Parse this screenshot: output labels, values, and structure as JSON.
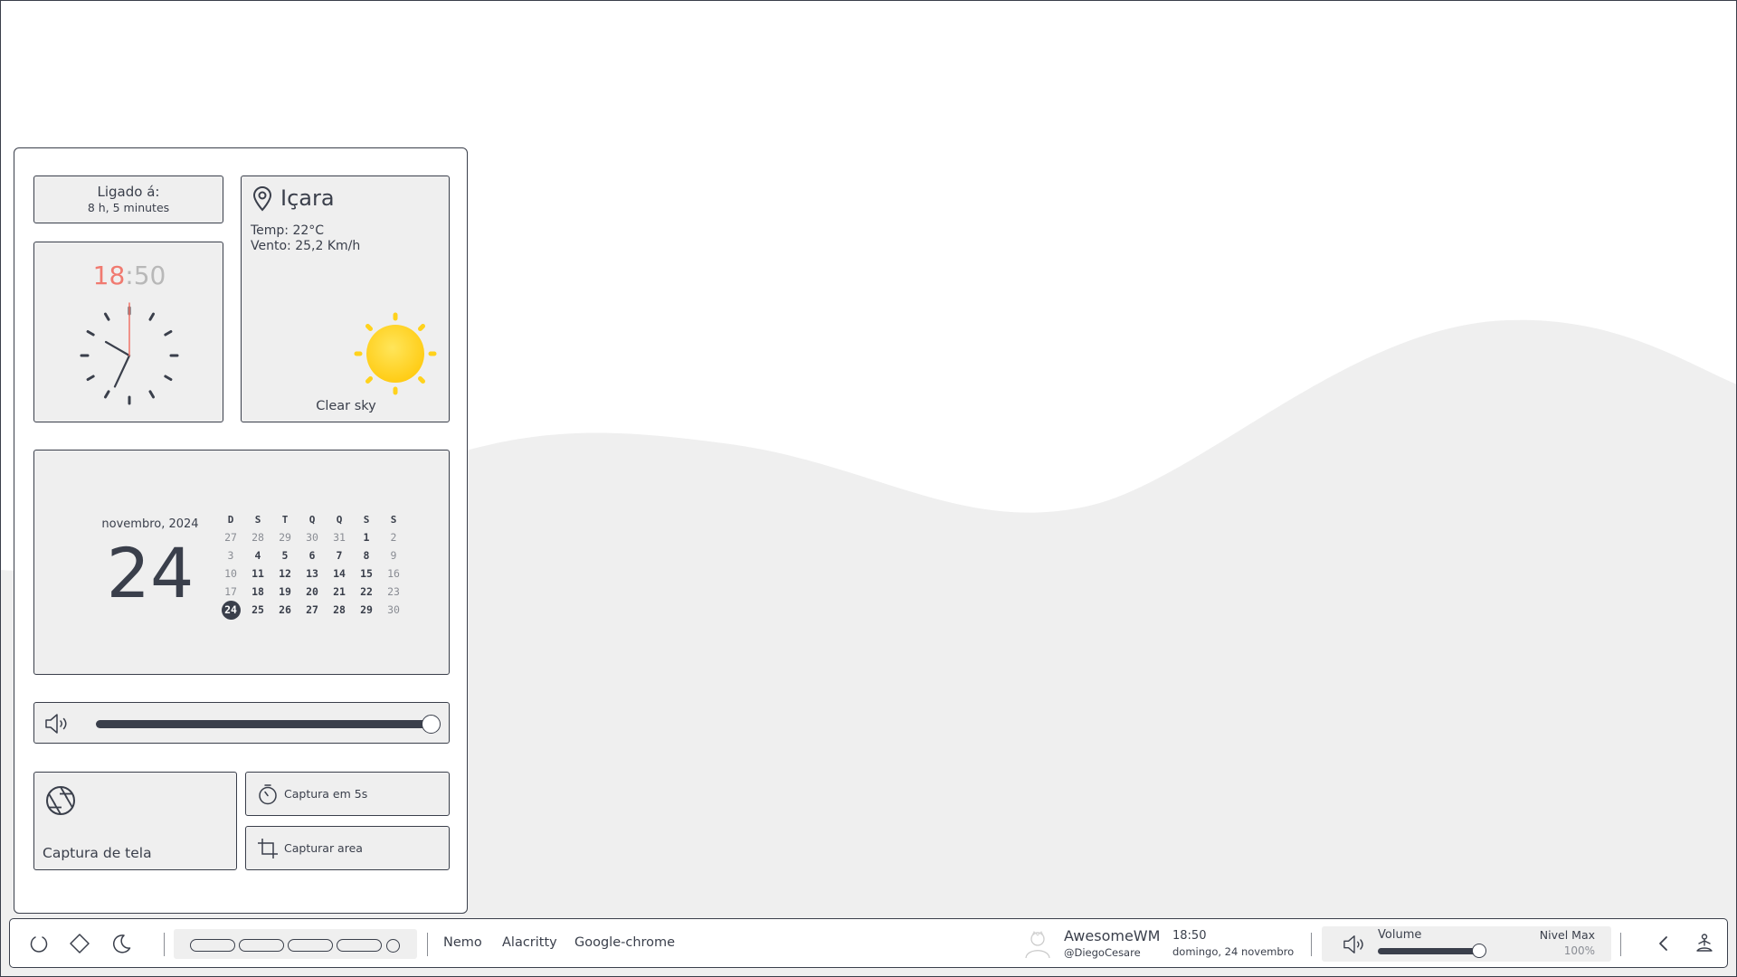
{
  "theme": {
    "fg": "#3a3f4b",
    "card_bg": "#efefef",
    "accent_hours": "#f07a70",
    "muted": "#b8b8b8",
    "sun": "#ffd21c"
  },
  "uptime": {
    "title": "Ligado á:",
    "value": "8 h, 5 minutes"
  },
  "clock": {
    "hours": "18",
    "separator": ":",
    "minutes": "50",
    "hour_value": 18,
    "minute_value": 50
  },
  "weather": {
    "icon": "map-pin-icon",
    "city": "Içara",
    "temp": "Temp: 22°C",
    "wind": "Vento: 25,2 Km/h",
    "condition_icon": "sun-icon",
    "description": "Clear sky"
  },
  "calendar": {
    "month_year": "novembro, 2024",
    "day": "24",
    "weekdays": [
      "D",
      "S",
      "T",
      "Q",
      "Q",
      "S",
      "S"
    ],
    "weeks": [
      [
        {
          "d": "27",
          "s": "dim"
        },
        {
          "d": "28",
          "s": "dim"
        },
        {
          "d": "29",
          "s": "dim"
        },
        {
          "d": "30",
          "s": "dim"
        },
        {
          "d": "31",
          "s": "dim"
        },
        {
          "d": "1",
          "s": "bold"
        },
        {
          "d": "2",
          "s": "dim"
        }
      ],
      [
        {
          "d": "3",
          "s": "dim"
        },
        {
          "d": "4",
          "s": "bold"
        },
        {
          "d": "5",
          "s": "bold"
        },
        {
          "d": "6",
          "s": "bold"
        },
        {
          "d": "7",
          "s": "bold"
        },
        {
          "d": "8",
          "s": "bold"
        },
        {
          "d": "9",
          "s": "dim"
        }
      ],
      [
        {
          "d": "10",
          "s": "dim"
        },
        {
          "d": "11",
          "s": "bold"
        },
        {
          "d": "12",
          "s": "bold"
        },
        {
          "d": "13",
          "s": "bold"
        },
        {
          "d": "14",
          "s": "bold"
        },
        {
          "d": "15",
          "s": "bold"
        },
        {
          "d": "16",
          "s": "dim"
        }
      ],
      [
        {
          "d": "17",
          "s": "dim"
        },
        {
          "d": "18",
          "s": "bold"
        },
        {
          "d": "19",
          "s": "bold"
        },
        {
          "d": "20",
          "s": "bold"
        },
        {
          "d": "21",
          "s": "bold"
        },
        {
          "d": "22",
          "s": "bold"
        },
        {
          "d": "23",
          "s": "dim"
        }
      ],
      [
        {
          "d": "24",
          "s": "today"
        },
        {
          "d": "25",
          "s": "bold"
        },
        {
          "d": "26",
          "s": "bold"
        },
        {
          "d": "27",
          "s": "bold"
        },
        {
          "d": "28",
          "s": "bold"
        },
        {
          "d": "29",
          "s": "bold"
        },
        {
          "d": "30",
          "s": "dim"
        }
      ]
    ]
  },
  "volume_panel": {
    "icon": "speaker-icon",
    "level": 1.0
  },
  "screenshot": {
    "main_icon": "camera-aperture-icon",
    "main_label": "Captura de tela",
    "delay_icon": "stopwatch-icon",
    "delay_label": "Captura em 5s",
    "area_icon": "crop-icon",
    "area_label": "Capturar area"
  },
  "bottom_bar": {
    "power_icons": [
      "power-icon",
      "diamond-icon",
      "moon-icon"
    ],
    "workspaces": {
      "count": 5,
      "active_shape": "circle"
    },
    "tasks": [
      "Nemo",
      "Alacritty",
      "Google-chrome"
    ],
    "profile": {
      "name": "AwesomeWM",
      "handle": "@DiegoCesare",
      "icon": "avatar-icon"
    },
    "time": "18:50",
    "date": "domingo, 24 novembro",
    "volume": {
      "label": "Volume",
      "max_label": "Nivel Max",
      "percent": "100%",
      "level": 0.82
    },
    "right_icons": [
      "chevron-left-icon",
      "meditation-icon"
    ]
  }
}
